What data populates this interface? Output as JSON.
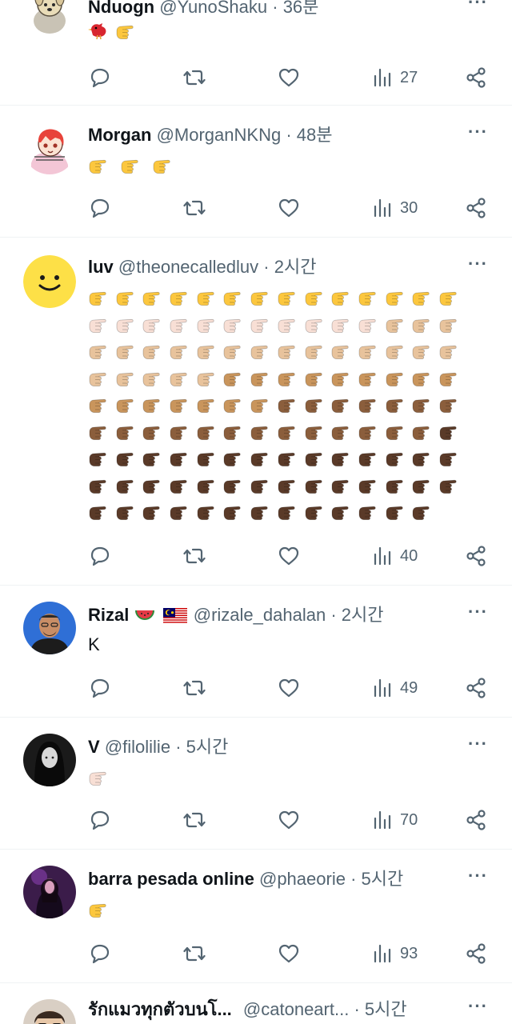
{
  "posts": [
    {
      "name": "Nduogn",
      "handle": "@YunoShaku",
      "time": "36분",
      "views": "27"
    },
    {
      "name": "Morgan",
      "handle": "@MorganNKNg",
      "time": "48분",
      "views": "30"
    },
    {
      "name": "luv",
      "handle": "@theonecalledluv",
      "time": "2시간",
      "views": "40"
    },
    {
      "name": "Rizal",
      "handle": "@rizale_dahalan",
      "time": "2시간",
      "text": "K",
      "views": "49"
    },
    {
      "name": "V",
      "handle": "@filolilie",
      "time": "5시간",
      "views": "70"
    },
    {
      "name": "barra pesada online",
      "handle": "@phaeorie",
      "time": "5시간",
      "views": "93"
    },
    {
      "name": "รักแมวทุกตัวบนโ...",
      "handle": "@catoneart...",
      "time": "5시간"
    }
  ],
  "separator": "·",
  "more_label": "···",
  "icons": {
    "reply": "reply-icon",
    "repost": "repost-icon",
    "like": "heart-icon",
    "views": "bar-chart-icon",
    "share": "share-icon",
    "more": "more-dots-icon"
  },
  "emoji": {
    "post1": [
      "bird",
      "pointing-hand-default"
    ],
    "post2": [
      "pointing-hand-default",
      "pointing-hand-default",
      "pointing-hand-default"
    ],
    "post4_after_name": [
      "watermelon",
      "malaysia-flag"
    ],
    "post5": [
      "pointing-hand-light"
    ],
    "post6": [
      "pointing-hand-default"
    ]
  },
  "hand_grid": {
    "emoji": "pointing-hand",
    "tones": {
      "default": "#fcc73e",
      "light": "#f8dfd5",
      "medium-light": "#e8c39c",
      "medium": "#c9955c",
      "medium-dark": "#8b5e3c",
      "dark": "#5a3a28"
    },
    "rows": [
      [
        "default",
        "default",
        "default",
        "default",
        "default",
        "default",
        "default",
        "default",
        "default",
        "default",
        "default",
        "default",
        "default",
        "default"
      ],
      [
        "light",
        "light",
        "light",
        "light",
        "light",
        "light",
        "light",
        "light",
        "light",
        "light",
        "light",
        "medium-light",
        "medium-light",
        "medium-light"
      ],
      [
        "medium-light",
        "medium-light",
        "medium-light",
        "medium-light",
        "medium-light",
        "medium-light",
        "medium-light",
        "medium-light",
        "medium-light",
        "medium-light",
        "medium-light",
        "medium-light",
        "medium-light",
        "medium-light"
      ],
      [
        "medium-light",
        "medium-light",
        "medium-light",
        "medium-light",
        "medium-light",
        "medium",
        "medium",
        "medium",
        "medium",
        "medium",
        "medium",
        "medium",
        "medium",
        "medium"
      ],
      [
        "medium",
        "medium",
        "medium",
        "medium",
        "medium",
        "medium",
        "medium",
        "medium-dark",
        "medium-dark",
        "medium-dark",
        "medium-dark",
        "medium-dark",
        "medium-dark",
        "medium-dark"
      ],
      [
        "medium-dark",
        "medium-dark",
        "medium-dark",
        "medium-dark",
        "medium-dark",
        "medium-dark",
        "medium-dark",
        "medium-dark",
        "medium-dark",
        "medium-dark",
        "medium-dark",
        "medium-dark",
        "medium-dark",
        "dark"
      ],
      [
        "dark",
        "dark",
        "dark",
        "dark",
        "dark",
        "dark",
        "dark",
        "dark",
        "dark",
        "dark",
        "dark",
        "dark",
        "dark",
        "dark"
      ],
      [
        "dark",
        "dark",
        "dark",
        "dark",
        "dark",
        "dark",
        "dark",
        "dark",
        "dark",
        "dark",
        "dark",
        "dark",
        "dark",
        "dark"
      ],
      [
        "dark",
        "dark",
        "dark",
        "dark",
        "dark",
        "dark",
        "dark",
        "dark",
        "dark",
        "dark",
        "dark",
        "dark",
        "dark"
      ]
    ]
  },
  "colors": {
    "text": "#0f1419",
    "secondary": "#536471",
    "divider": "#eff3f4"
  }
}
